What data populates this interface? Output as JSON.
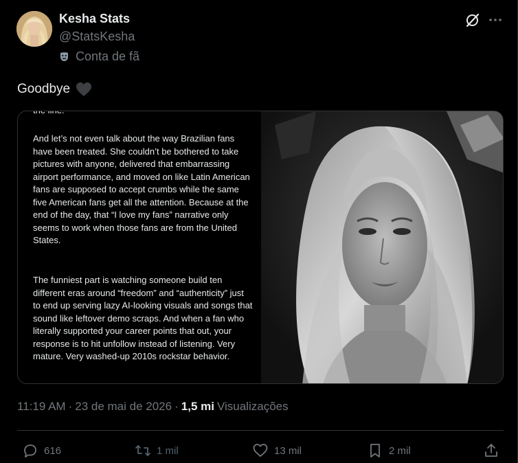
{
  "author": {
    "name": "Kesha Stats",
    "handle": "@StatsKesha",
    "fan_label": "Conta de fã",
    "avatar_icon": "avatar"
  },
  "header_actions": {
    "grok_icon": "grok-icon",
    "more_icon": "more-icon"
  },
  "tweet": {
    "text": "Goodbye",
    "emoji": "black-heart"
  },
  "media": {
    "cut_top_text": "the line.",
    "paragraph_1": "And let’s not even talk about the way Brazilian fans have been treated. She couldn’t be bothered to take pictures with anyone, delivered that embarrassing airport performance, and moved on like Latin American fans are supposed to accept crumbs while the same five American fans get all the attention. Because at the end of the day, that “I love my fans” narrative only seems to work when those fans are from the United States.",
    "paragraph_2": "The funniest part is watching someone build ten different eras around “freedom” and “authenticity” just to end up serving lazy AI-looking visuals and songs that sound like leftover demo scraps. And when a fan who literally supported your career points that out, your response is to hit unfollow instead of listening. Very mature. Very washed-up 2010s rockstar behavior."
  },
  "meta": {
    "time": "11:19 AM",
    "separator": "·",
    "date": "23 de mai de 2026",
    "separator2": "·",
    "views_count": "1,5 mi",
    "views_label": "Visualizações"
  },
  "actions": {
    "replies": "616",
    "reposts": "1 mil",
    "likes": "13 mil",
    "bookmarks": "2 mil"
  },
  "colors": {
    "background": "#000000",
    "text": "#e7e9ea",
    "muted": "#71767b",
    "border": "#2f3336"
  }
}
